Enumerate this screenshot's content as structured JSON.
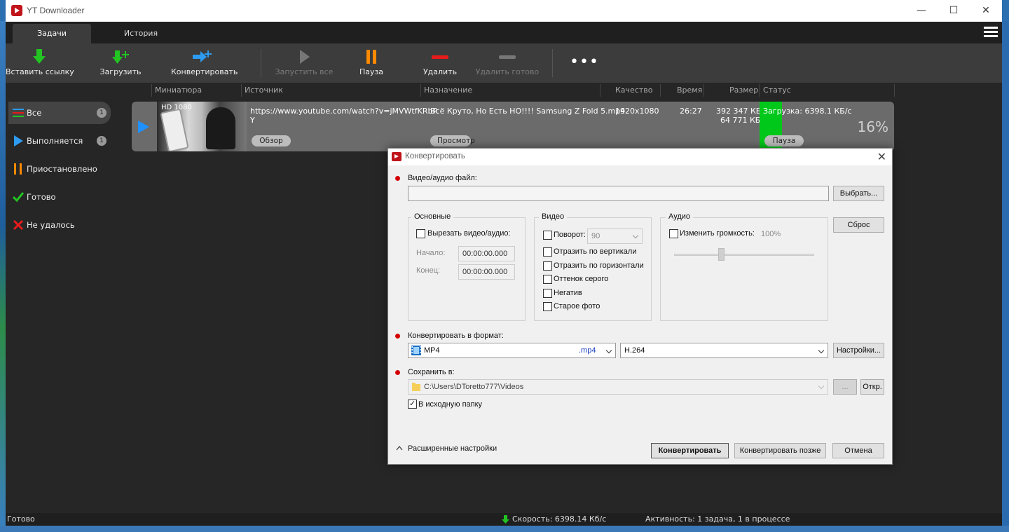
{
  "window": {
    "title": "YT Downloader"
  },
  "tabs": [
    {
      "label": "Задачи"
    },
    {
      "label": "История"
    }
  ],
  "toolbar": {
    "paste_link": "Вставить ссылку",
    "download": "Загрузить",
    "convert": "Конвертировать",
    "start_all": "Запустить все",
    "pause": "Пауза",
    "delete": "Удалить",
    "delete_done": "Удалить готово",
    "more": "•••"
  },
  "sidebar": {
    "items": [
      {
        "label": "Все",
        "count": "1",
        "icon": "list-icon"
      },
      {
        "label": "Выполняется",
        "count": "1",
        "icon": "play-icon"
      },
      {
        "label": "Приостановлено",
        "icon": "pause-icon"
      },
      {
        "label": "Готово",
        "icon": "check-icon"
      },
      {
        "label": "Не удалось",
        "icon": "x-icon"
      }
    ]
  },
  "columns": {
    "thumbnail": "Миниатюра",
    "source": "Источник",
    "destination": "Назначение",
    "quality": "Качество",
    "time": "Время",
    "size": "Размер",
    "status": "Статус"
  },
  "task": {
    "badge": "HD 1080",
    "source_line1": "https://www.youtube.com/watch?v=jMVWtfKRbR",
    "source_line2": "Y",
    "browse": "Обзор",
    "destination": "Всё Круто, Но Есть НО!!!! Samsung Z Fold 5.mp4",
    "preview": "Просмотр",
    "quality": "1920x1080",
    "time": "26:27",
    "size_total": "392 347 КБ",
    "size_done": "64 771 КБ",
    "status": "Загрузка: 6398.1 КБ/с",
    "progress_percent": 16,
    "percent_label": "16%",
    "pause": "Пауза"
  },
  "statusbar": {
    "left": "Готово",
    "speed": "Скорость: 6398.14 Кб/с",
    "activity": "Активность: 1 задача, 1 в процессе"
  },
  "dialog": {
    "title": "Конвертировать",
    "file_label": "Видео/аудио файл:",
    "file_value": "",
    "choose": "Выбрать...",
    "reset": "Сброс",
    "basic": {
      "title": "Основные",
      "cut": "Вырезать видео/аудио:",
      "start_label": "Начало:",
      "start_value": "00:00:00.000",
      "end_label": "Конец:",
      "end_value": "00:00:00.000"
    },
    "video": {
      "title": "Видео",
      "rotate": "Поворот:",
      "rotate_value": "90",
      "flip_v": "Отразить по вертикали",
      "flip_h": "Отразить по горизонтали",
      "gray": "Оттенок серого",
      "negative": "Негатив",
      "old_photo": "Старое фото"
    },
    "audio": {
      "title": "Аудио",
      "volume": "Изменить громкость:",
      "volume_value": "100%"
    },
    "format_label": "Конвертировать в формат:",
    "format": "MP4",
    "format_ext": ".mp4",
    "codec": "H.264",
    "settings": "Настройки...",
    "save_label": "Сохранить в:",
    "save_path": "C:\\Users\\DToretto777\\Videos",
    "browse": "...",
    "open": "Откр.",
    "source_folder": "В исходную папку",
    "advanced": "Расширенные настройки",
    "convert": "Конвертировать",
    "convert_later": "Конвертировать позже",
    "cancel": "Отмена"
  }
}
